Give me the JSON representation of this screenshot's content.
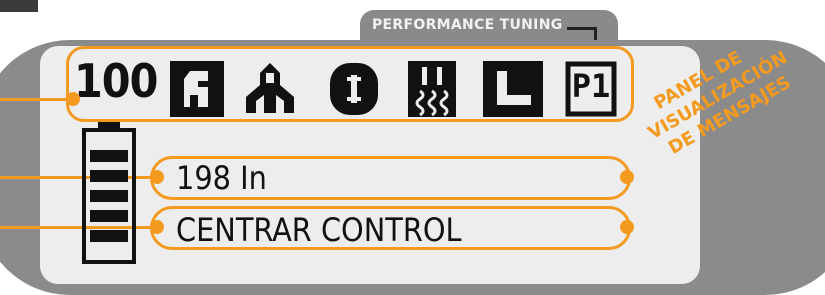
{
  "performance_tuning": {
    "label": "PERFORMANCE TUNING"
  },
  "display": {
    "level_value": "100",
    "icons": [
      {
        "name": "wrench-icon"
      },
      {
        "name": "operator-seat-icon"
      },
      {
        "name": "cylinder-icon"
      },
      {
        "name": "heat-icon"
      },
      {
        "name": "l-bracket-icon"
      },
      {
        "name": "p1-icon",
        "text": "P1"
      }
    ],
    "battery_bars": 5,
    "message_line1": "198 In",
    "message_line2": "CENTRAR CONTROL"
  },
  "annotation": {
    "lines": [
      "PANEL DE",
      "VISUALIZACIÓN",
      "DE MENSAJES"
    ]
  },
  "colors": {
    "accent": "#f39a1f",
    "bezel": "#8b8b8b",
    "lcd": "#ededed",
    "ink": "#111111"
  }
}
